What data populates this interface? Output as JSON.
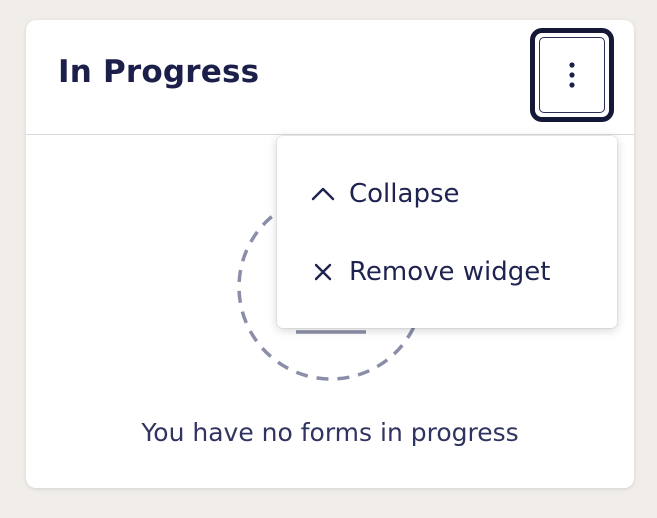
{
  "widget": {
    "title": "In Progress",
    "menu_button_icon": "vertical-ellipsis-icon"
  },
  "empty_state": {
    "icon": "empty-document-circle-icon",
    "message": "You have no forms in progress"
  },
  "menu": {
    "items": [
      {
        "icon": "chevron-up-icon",
        "label": "Collapse"
      },
      {
        "icon": "close-icon",
        "label": "Remove widget"
      }
    ]
  },
  "colors": {
    "page_background": "#f1eeea",
    "card_background": "#ffffff",
    "text_primary": "#1c1f4a",
    "text_secondary": "#2f3460",
    "focus_ring": "#141736",
    "dashed_circle": "#8b8ea8"
  }
}
